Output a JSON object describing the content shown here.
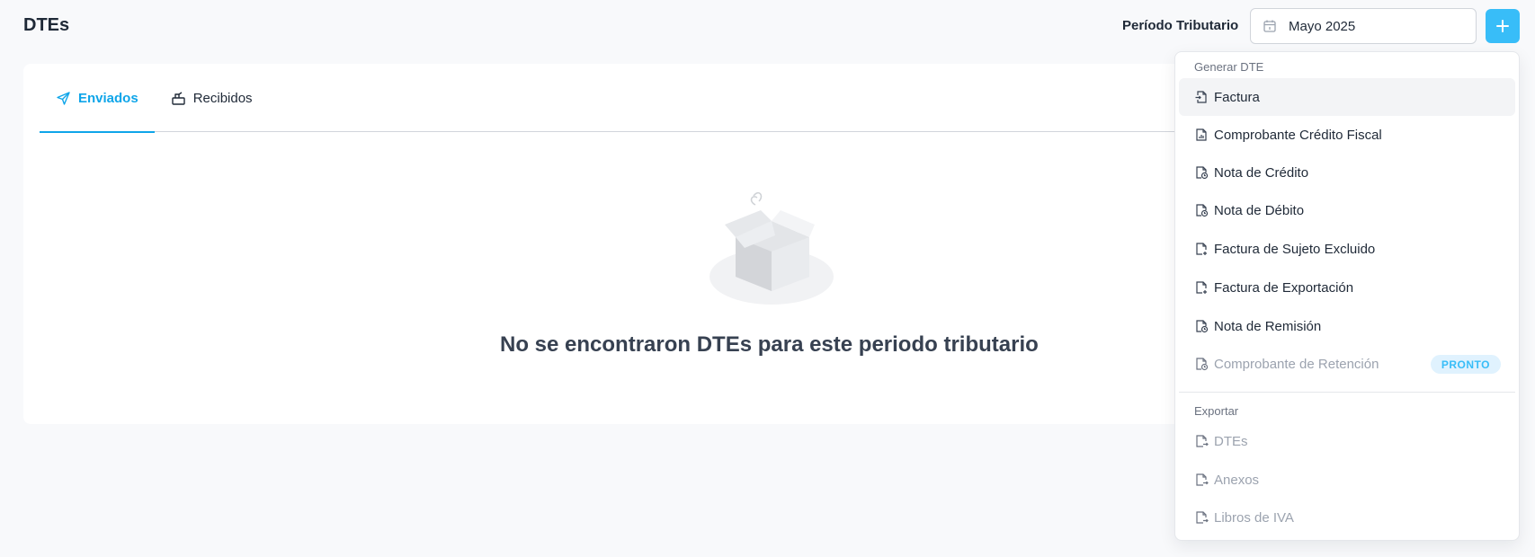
{
  "page": {
    "title": "DTEs"
  },
  "period": {
    "label": "Período Tributario",
    "value": "Mayo 2025",
    "icon": "calendar-icon"
  },
  "add_button": {
    "icon": "plus-icon"
  },
  "tabs": [
    {
      "label": "Enviados",
      "icon": "send-icon",
      "active": true
    },
    {
      "label": "Recibidos",
      "icon": "inbox-icon",
      "active": false
    }
  ],
  "empty_state": {
    "icon": "empty-box-illustration",
    "message": "No se encontraron DTEs para este periodo tributario"
  },
  "dropdown": {
    "generate_header": "Generar DTE",
    "generate_items": [
      {
        "label": "Factura",
        "icon": "file-import-icon",
        "disabled": false
      },
      {
        "label": "Comprobante Crédito Fiscal",
        "icon": "file-chart-icon",
        "disabled": false
      },
      {
        "label": "Nota de Crédito",
        "icon": "file-clock-icon",
        "disabled": false
      },
      {
        "label": "Nota de Débito",
        "icon": "file-clock-icon",
        "disabled": false
      },
      {
        "label": "Factura de Sujeto Excluido",
        "icon": "file-plus-icon",
        "disabled": false
      },
      {
        "label": "Factura de Exportación",
        "icon": "file-plus-icon",
        "disabled": false
      },
      {
        "label": "Nota de Remisión",
        "icon": "file-clock-icon",
        "disabled": false
      },
      {
        "label": "Comprobante de Retención",
        "icon": "file-clock-icon",
        "disabled": true,
        "badge": "PRONTO"
      }
    ],
    "export_header": "Exportar",
    "export_items": [
      {
        "label": "DTEs",
        "icon": "file-export-icon",
        "disabled": true
      },
      {
        "label": "Anexos",
        "icon": "file-export-icon",
        "disabled": true
      },
      {
        "label": "Libros de IVA",
        "icon": "file-export-icon",
        "disabled": true
      }
    ]
  },
  "colors": {
    "accent": "#0ea5e9",
    "button": "#38bdf8",
    "background": "#f8f9fb"
  }
}
